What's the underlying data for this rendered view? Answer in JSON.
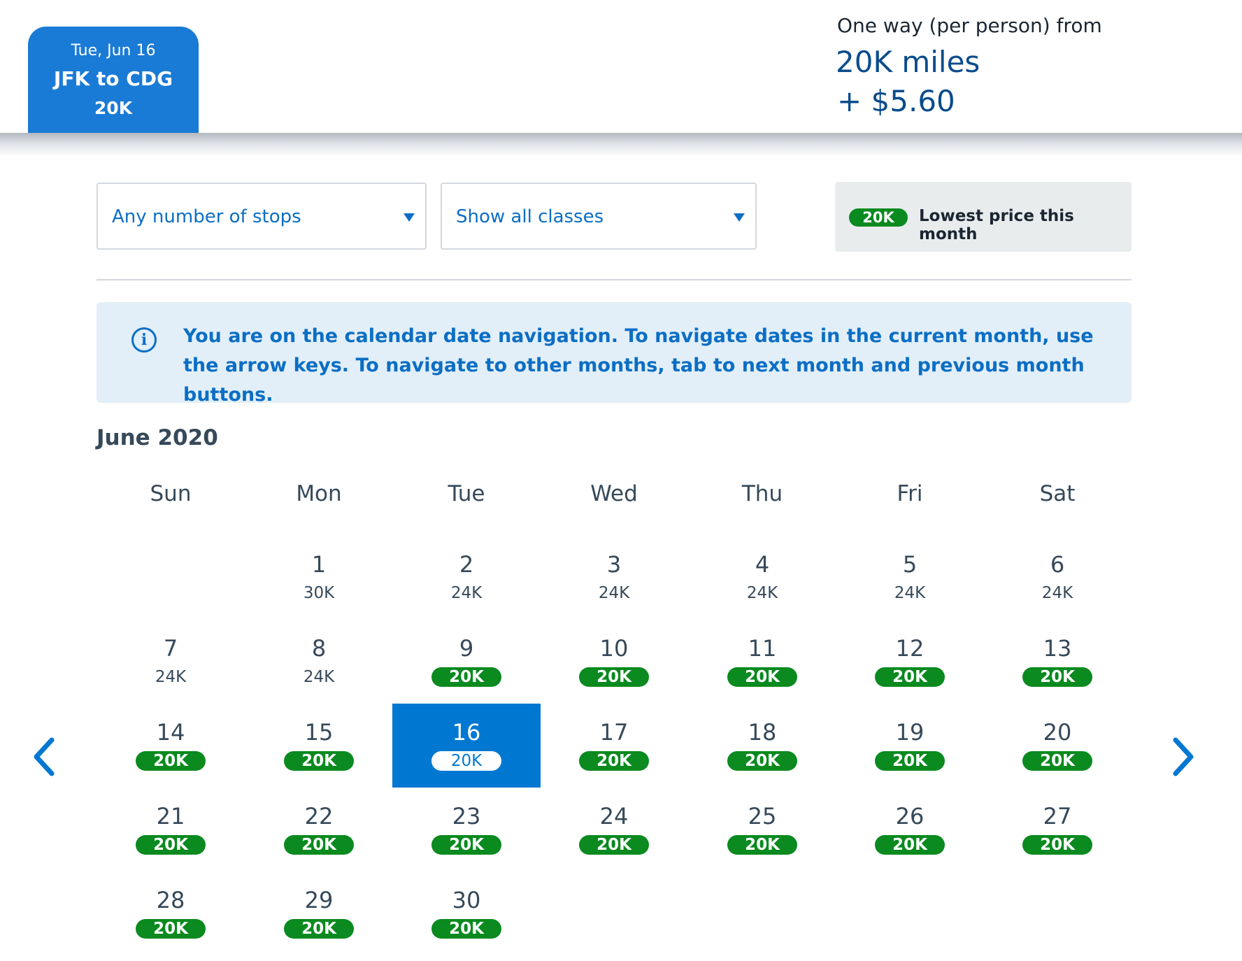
{
  "trip": {
    "date": "Tue, Jun 16",
    "route": "JFK to CDG",
    "price": "20K"
  },
  "fare": {
    "caption": "One way (per person) from",
    "miles": "20K miles",
    "fee": "+ $5.60"
  },
  "filters": {
    "stops": "Any number of stops",
    "classes": "Show all classes"
  },
  "legend": {
    "badge": "20K",
    "label": "Lowest price this month"
  },
  "info": {
    "icon": "info-icon",
    "text": "You are on the calendar date navigation. To navigate dates in the current month, use the arrow keys. To navigate to other months, tab to next month and previous month buttons."
  },
  "calendar": {
    "month": "June 2020",
    "weekdays": [
      "Sun",
      "Mon",
      "Tue",
      "Wed",
      "Thu",
      "Fri",
      "Sat"
    ],
    "selected_day": 16,
    "days": [
      {
        "day": "1",
        "price": "30K",
        "lowest": false
      },
      {
        "day": "2",
        "price": "24K",
        "lowest": false
      },
      {
        "day": "3",
        "price": "24K",
        "lowest": false
      },
      {
        "day": "4",
        "price": "24K",
        "lowest": false
      },
      {
        "day": "5",
        "price": "24K",
        "lowest": false
      },
      {
        "day": "6",
        "price": "24K",
        "lowest": false
      },
      {
        "day": "7",
        "price": "24K",
        "lowest": false
      },
      {
        "day": "8",
        "price": "24K",
        "lowest": false
      },
      {
        "day": "9",
        "price": "20K",
        "lowest": true
      },
      {
        "day": "10",
        "price": "20K",
        "lowest": true
      },
      {
        "day": "11",
        "price": "20K",
        "lowest": true
      },
      {
        "day": "12",
        "price": "20K",
        "lowest": true
      },
      {
        "day": "13",
        "price": "20K",
        "lowest": true
      },
      {
        "day": "14",
        "price": "20K",
        "lowest": true
      },
      {
        "day": "15",
        "price": "20K",
        "lowest": true
      },
      {
        "day": "16",
        "price": "20K",
        "lowest": true
      },
      {
        "day": "17",
        "price": "20K",
        "lowest": true
      },
      {
        "day": "18",
        "price": "20K",
        "lowest": true
      },
      {
        "day": "19",
        "price": "20K",
        "lowest": true
      },
      {
        "day": "20",
        "price": "20K",
        "lowest": true
      },
      {
        "day": "21",
        "price": "20K",
        "lowest": true
      },
      {
        "day": "22",
        "price": "20K",
        "lowest": true
      },
      {
        "day": "23",
        "price": "20K",
        "lowest": true
      },
      {
        "day": "24",
        "price": "20K",
        "lowest": true
      },
      {
        "day": "25",
        "price": "20K",
        "lowest": true
      },
      {
        "day": "26",
        "price": "20K",
        "lowest": true
      },
      {
        "day": "27",
        "price": "20K",
        "lowest": true
      },
      {
        "day": "28",
        "price": "20K",
        "lowest": true
      },
      {
        "day": "29",
        "price": "20K",
        "lowest": true
      },
      {
        "day": "30",
        "price": "20K",
        "lowest": true
      }
    ]
  },
  "nav": {
    "prev_icon": "chevron-left-icon",
    "next_icon": "chevron-right-icon"
  },
  "colors": {
    "brand_blue": "#0078d2",
    "lowest_green": "#0a8a1f",
    "text_dark": "#36495a"
  }
}
